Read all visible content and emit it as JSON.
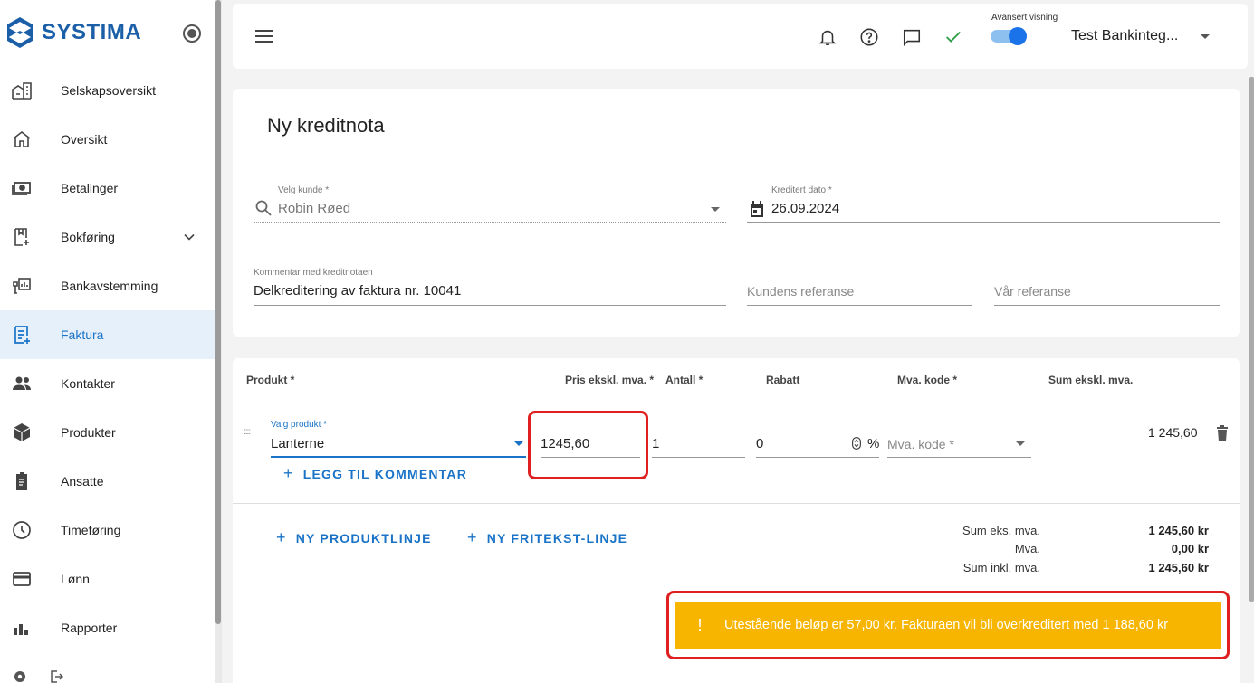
{
  "app": {
    "logo_text": "SYSTIMA"
  },
  "sidebar": {
    "items": [
      {
        "label": "Selskapsoversikt",
        "icon": "building-icon"
      },
      {
        "label": "Oversikt",
        "icon": "home-icon"
      },
      {
        "label": "Betalinger",
        "icon": "money-icon"
      },
      {
        "label": "Bokføring",
        "icon": "book-add-icon"
      },
      {
        "label": "Bankavstemming",
        "icon": "bank-reconcile-icon"
      },
      {
        "label": "Faktura",
        "icon": "invoice-icon"
      },
      {
        "label": "Kontakter",
        "icon": "people-icon"
      },
      {
        "label": "Produkter",
        "icon": "box-icon"
      },
      {
        "label": "Ansatte",
        "icon": "badge-icon"
      },
      {
        "label": "Timeføring",
        "icon": "clock-icon"
      },
      {
        "label": "Lønn",
        "icon": "card-icon"
      },
      {
        "label": "Rapporter",
        "icon": "report-icon"
      }
    ],
    "active_index": 5
  },
  "topbar": {
    "advanced_view_label": "Avansert visning",
    "advanced_view_on": true,
    "company_name": "Test Bankinteg..."
  },
  "form": {
    "title": "Ny kreditnota",
    "customer": {
      "label": "Velg kunde *",
      "value": "Robin Røed"
    },
    "credit_date": {
      "label": "Kreditert dato *",
      "value": "26.09.2024"
    },
    "comment": {
      "label": "Kommentar med kreditnotaen",
      "value": "Delkreditering av faktura nr. 10041"
    },
    "customer_ref": {
      "placeholder": "Kundens referanse"
    },
    "our_ref": {
      "placeholder": "Vår referanse"
    }
  },
  "products": {
    "headers": {
      "product": "Produkt *",
      "price": "Pris ekskl. mva. *",
      "qty": "Antall *",
      "discount": "Rabatt",
      "vat_code": "Mva. kode *",
      "sum": "Sum ekskl. mva."
    },
    "row": {
      "product_label": "Valg produkt *",
      "product": "Lanterne",
      "price": "1245,60",
      "qty": "1",
      "discount": "0",
      "discount_unit": "%",
      "vat_placeholder": "Mva. kode *",
      "sum": "1 245,60"
    },
    "drag_handle": "::::",
    "add_comment": "LEGG TIL KOMMENTAR",
    "new_product_line": "NY PRODUKTLINJE",
    "new_freetext_line": "NY FRITEKST-LINJE"
  },
  "totals": {
    "sum_ex_label": "Sum eks. mva.",
    "sum_ex_value": "1 245,60 kr",
    "vat_label": "Mva.",
    "vat_value": "0,00 kr",
    "sum_inc_label": "Sum inkl. mva.",
    "sum_inc_value": "1 245,60 kr"
  },
  "warning": {
    "icon": "!",
    "text": "Utestående beløp er 57,00 kr. Fakturaen vil bli overkreditert med 1 188,60 kr"
  },
  "colors": {
    "brand": "#1a5fa8",
    "accent": "#1a73c7",
    "warning": "#f7b500",
    "highlight": "#e02020",
    "success": "#2e9e44"
  }
}
